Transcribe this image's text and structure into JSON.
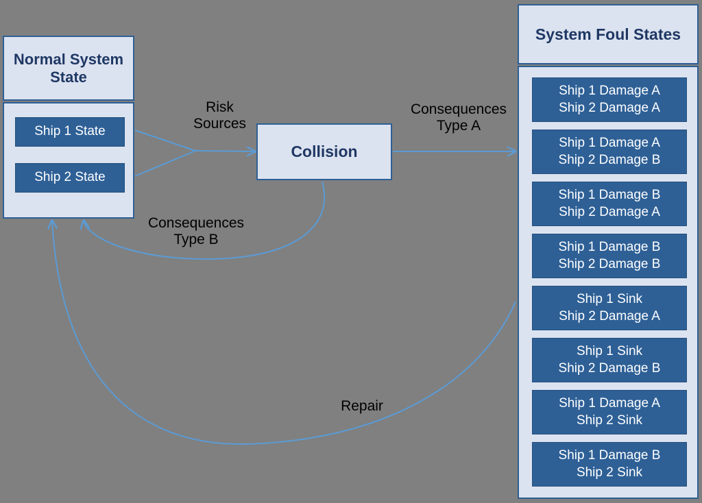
{
  "diagram": {
    "background_color": "#808080",
    "accent_color": "#2e6096",
    "panel_color": "#dce3f0",
    "arrow_color": "#5b9bd5"
  },
  "normal_state": {
    "title": "Normal\nSystem State",
    "chips": [
      {
        "label": "Ship 1 State"
      },
      {
        "label": "Ship 2 State"
      }
    ]
  },
  "collision": {
    "title": "Collision"
  },
  "foul_states": {
    "title": "System Foul States",
    "chips": [
      {
        "line1": "Ship 1 Damage A",
        "line2": "Ship 2 Damage A"
      },
      {
        "line1": "Ship 1 Damage A",
        "line2": "Ship 2 Damage B"
      },
      {
        "line1": "Ship 1 Damage B",
        "line2": "Ship 2 Damage A"
      },
      {
        "line1": "Ship 1 Damage B",
        "line2": "Ship 2 Damage B"
      },
      {
        "line1": "Ship 1 Sink",
        "line2": "Ship 2 Damage A"
      },
      {
        "line1": "Ship 1 Sink",
        "line2": "Ship 2 Damage B"
      },
      {
        "line1": "Ship 1 Damage A",
        "line2": "Ship 2 Sink"
      },
      {
        "line1": "Ship 1 Damage B",
        "line2": "Ship 2 Sink"
      }
    ]
  },
  "edges": {
    "risk_sources": "Risk\nSources",
    "consequences_type_a": "Consequences\nType A",
    "consequences_type_b": "Consequences\nType B",
    "repair": "Repair"
  }
}
